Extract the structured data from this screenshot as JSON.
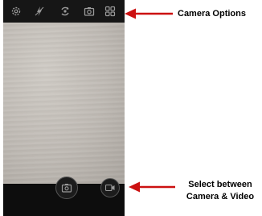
{
  "annotations": {
    "camera_options": "Camera Options",
    "select_line1": "Select between",
    "select_line2": "Camera & Video"
  },
  "colors": {
    "arrow": "#cc1111",
    "icon": "#9a9a9a"
  },
  "icons": {
    "topbar": [
      "settings-gear-icon",
      "flash-icon",
      "switch-camera-icon",
      "camera-mode-icon",
      "grid-icon"
    ],
    "bottombar": [
      "camera-shutter-icon",
      "video-record-icon"
    ]
  }
}
